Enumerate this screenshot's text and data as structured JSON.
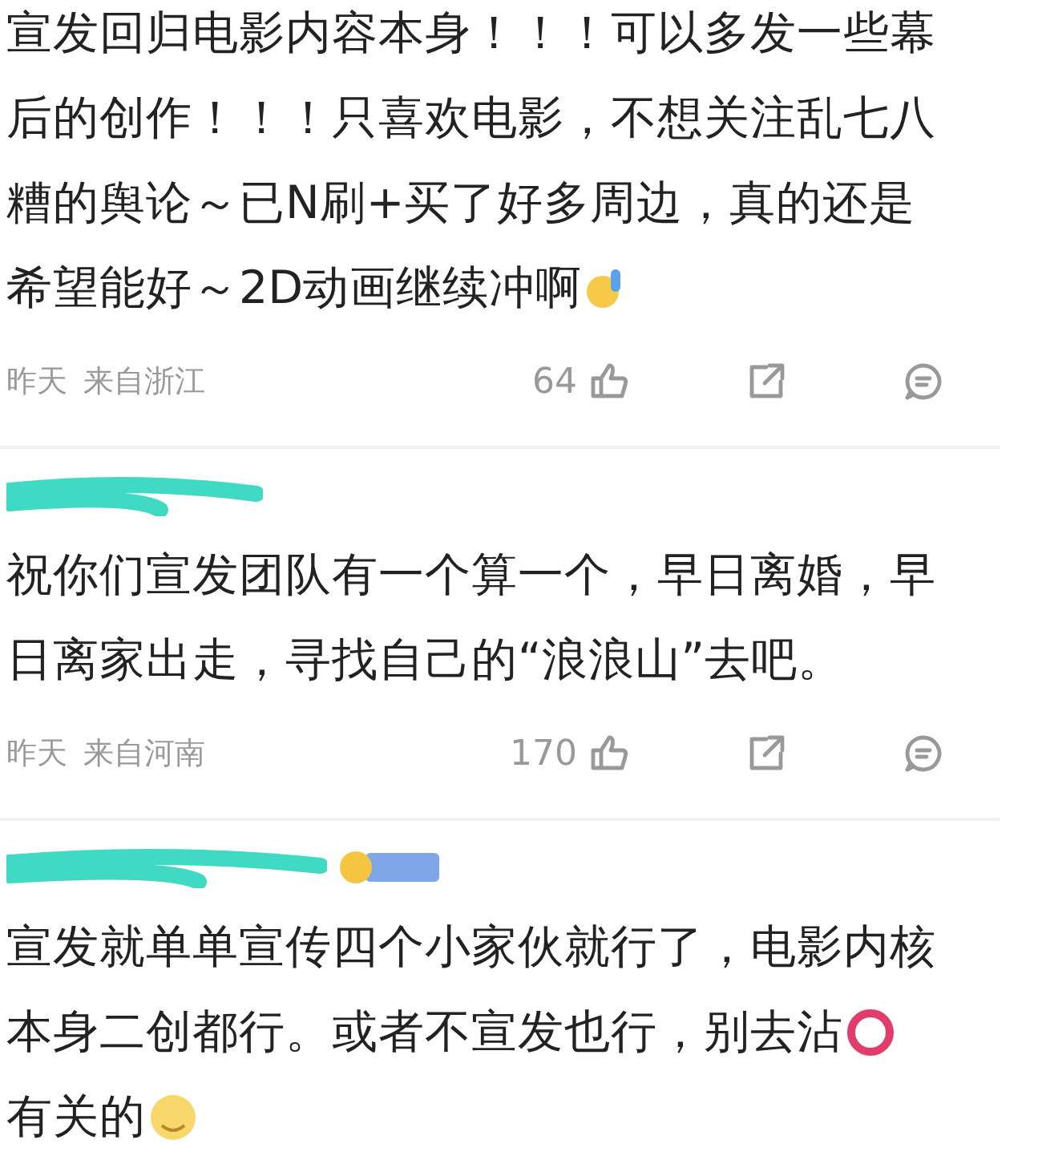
{
  "comments": [
    {
      "kind": "continued",
      "lines": [
        {
          "kind": "plain",
          "text": "宣发回归电影内容本身！！！可以多发一些幕"
        },
        {
          "kind": "plain",
          "text": "后的创作！！！只喜欢电影，不想关注乱七八"
        },
        {
          "kind": "plain",
          "text": "糟的舆论～已N刷+买了好多周边，真的还是"
        },
        {
          "kind": "salute",
          "text": "希望能好～2D动画继续冲啊"
        }
      ],
      "time": "昨天",
      "location": "来自浙江",
      "likes": "64"
    },
    {
      "kind": "redacted",
      "lines": [
        {
          "kind": "plain",
          "text": "祝你们宣发团队有一个算一个，早日离婚，早"
        },
        {
          "kind": "plain",
          "text": "日离家出走，寻找自己的“浪浪山”去吧。"
        }
      ],
      "time": "昨天",
      "location": "来自河南",
      "likes": "170"
    },
    {
      "kind": "redacted-badge",
      "lines": [
        {
          "kind": "plain",
          "text": "宣发就单单宣传四个小家伙就行了，电影内核"
        },
        {
          "kind": "ring",
          "text": "本身二创都行。或者不宣发也行，别去沾"
        },
        {
          "kind": "smile",
          "text": "有关的"
        }
      ]
    }
  ]
}
